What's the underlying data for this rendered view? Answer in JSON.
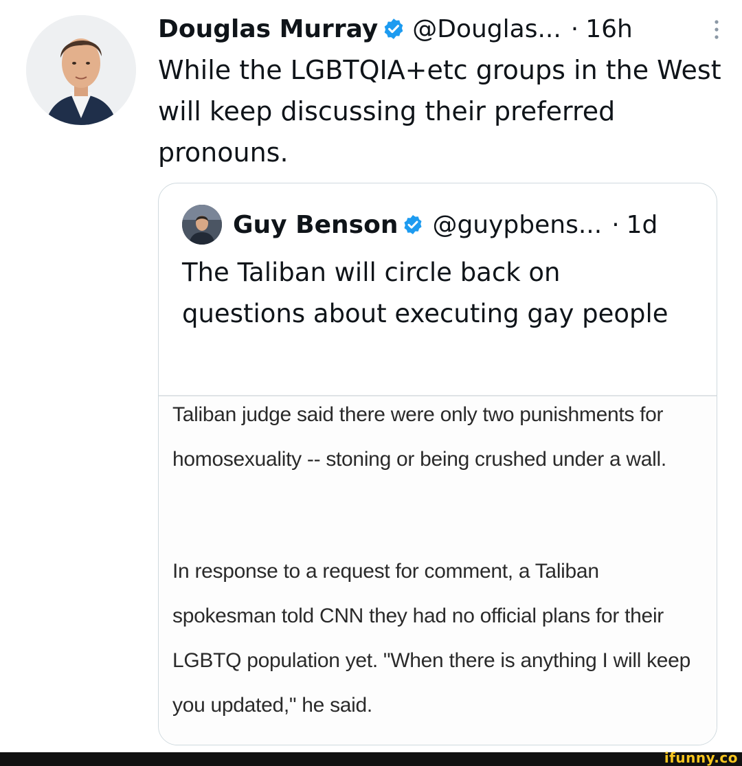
{
  "tweet": {
    "author_name": "Douglas Murray",
    "handle": "@Douglas...",
    "separator": "·",
    "time": "16h",
    "text": "While the LGBTQIA+etc groups in the West will keep discussing their preferred pronouns.",
    "icons": {
      "verified": "verified-badge-icon",
      "more": "more-options-icon"
    }
  },
  "quote": {
    "author_name": "Guy Benson",
    "handle": "@guypbens...",
    "separator": "·",
    "time": "1d",
    "text": "The Taliban will circle back on questions about executing gay people",
    "image_text": {
      "paragraph_1": "Taliban judge said there were only two punishments for homosexuality -- stoning or being crushed under a wall.",
      "paragraph_2": "In response to a request for comment, a Taliban spokesman told CNN they had no official plans for their LGBTQ population yet. \"When there is anything I will keep you updated,\" he said."
    }
  },
  "watermark": "ifunny.co",
  "colors": {
    "verified_blue": "#1d9bf0",
    "border": "#cfd9de",
    "text": "#0f1419",
    "watermark": "#f7c51e"
  }
}
